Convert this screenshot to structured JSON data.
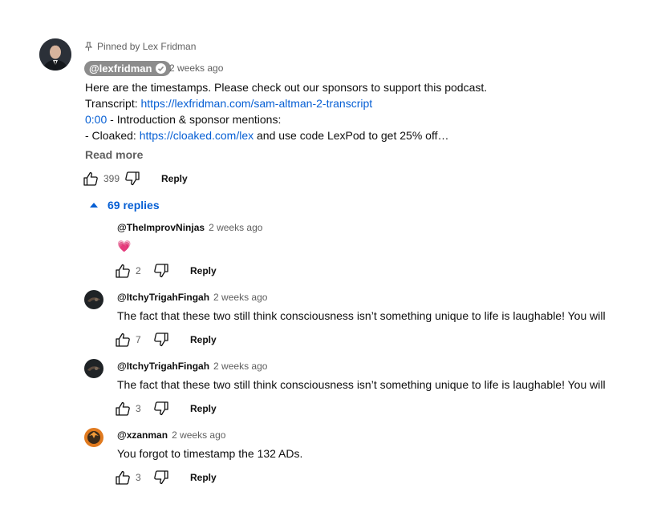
{
  "pinned_comment": {
    "pinned_label": "Pinned by Lex Fridman",
    "author": "@lexfridman",
    "time": "2 weeks ago",
    "line1": "Here are the timestamps. Please check out our sponsors to support this podcast.",
    "line2_prefix": "Transcript: ",
    "line2_link": "https://lexfridman.com/sam-altman-2-transcript",
    "line3_link": "0:00",
    "line3_text": " - Introduction & sponsor mentions:",
    "line4_prefix": "- Cloaked: ",
    "line4_link": "https://cloaked.com/lex",
    "line4_suffix": " and use code LexPod to get 25% off…",
    "read_more": "Read more",
    "likes": "399",
    "reply_label": "Reply"
  },
  "replies_toggle": {
    "label": "69 replies"
  },
  "replies": [
    {
      "author": "@TheImprovNinjas",
      "time": "2 weeks ago",
      "text": "💗",
      "likes": "2",
      "reply_label": "Reply"
    },
    {
      "author": "@ItchyTrigahFingah",
      "time": "2 weeks ago",
      "text": "The fact that these two still think consciousness isn’t something unique to life is laughable! You will",
      "likes": "7",
      "reply_label": "Reply"
    },
    {
      "author": "@ItchyTrigahFingah",
      "time": "2 weeks ago",
      "text": "The fact that these two still think consciousness isn’t something unique to life is laughable! You will",
      "likes": "3",
      "reply_label": "Reply"
    },
    {
      "author": "@xzanman",
      "time": "2 weeks ago",
      "text": "You forgot to timestamp the 132 ADs.",
      "likes": "3",
      "reply_label": "Reply"
    }
  ],
  "colors": {
    "link": "#065fd4",
    "secondary_text": "#606060",
    "chip_bg": "#8c8c8c"
  },
  "icons": [
    "pin-icon",
    "verified-check-icon",
    "like-icon",
    "dislike-icon",
    "caret-up-icon"
  ]
}
